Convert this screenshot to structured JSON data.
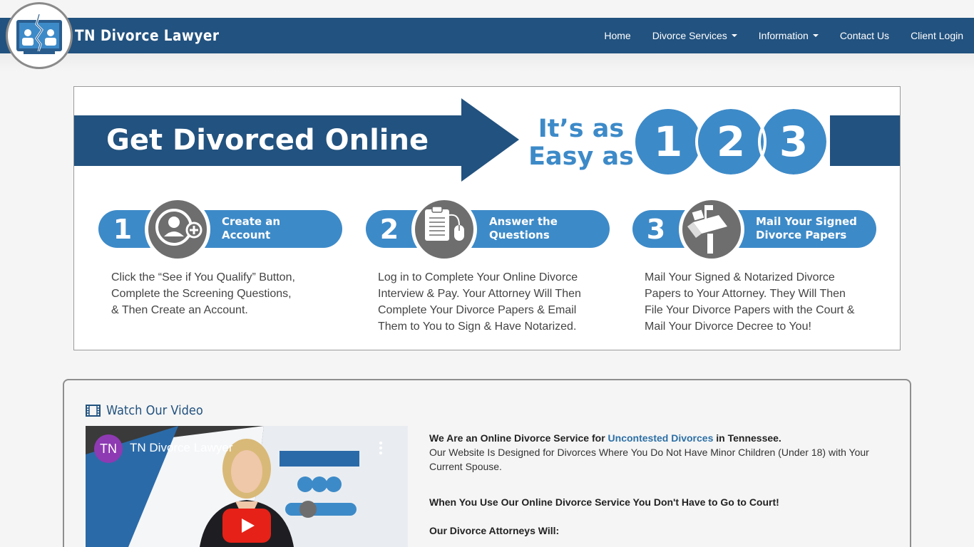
{
  "brand": {
    "name": "TN Divorce Lawyer"
  },
  "nav": {
    "home": "Home",
    "divorce_services": "Divorce Services",
    "information": "Information",
    "contact": "Contact Us",
    "login": "Client Login"
  },
  "banner": {
    "title": "Get Divorced Online",
    "easy_line1": "It’s as",
    "easy_line2": "Easy as",
    "big_numbers": [
      "1",
      "2",
      "3"
    ],
    "steps": [
      {
        "num": "1",
        "label_line1": "Create an",
        "label_line2": "Account",
        "icon": "user-plus-icon",
        "desc": [
          "Click the “See if You Qualify” Button,",
          "Complete the Screening Questions,",
          "& Then Create an Account."
        ]
      },
      {
        "num": "2",
        "label_line1": "Answer the",
        "label_line2": "Questions",
        "icon": "clipboard-mouse-icon",
        "desc": [
          "Log in to Complete Your Online Divorce",
          "Interview & Pay. Your Attorney Will Then",
          "Complete Your Divorce Papers & Email",
          "Them to You to Sign & Have Notarized."
        ]
      },
      {
        "num": "3",
        "label_line1": "Mail Your Signed",
        "label_line2": "Divorce Papers",
        "icon": "mailbox-icon",
        "desc": [
          "Mail Your Signed & Notarized Divorce",
          "Papers to Your Attorney. They Will Then",
          "File Your Divorce Papers with the Court &",
          "Mail Your Divorce Decree to You!"
        ]
      }
    ]
  },
  "video_section": {
    "heading": "Watch Our Video",
    "channel_initials": "TN",
    "video_title": "TN Divorce Lawyer"
  },
  "intro": {
    "line1_a": "We Are an Online Divorce Service for ",
    "line1_link": "Uncontested Divorces",
    "line1_b": " in Tennessee.",
    "line2": "Our Website Is Designed for Divorces Where You Do Not Have Minor Children (Under 18) with Your Current Spouse.",
    "line3": "When You Use Our Online Divorce Service You Don't Have to Go to Court!",
    "line4": "Our Divorce Attorneys Will:"
  },
  "colors": {
    "navy": "#22527f",
    "accent_blue": "#3d8ac8",
    "icon_gray": "#6e6e6e"
  }
}
